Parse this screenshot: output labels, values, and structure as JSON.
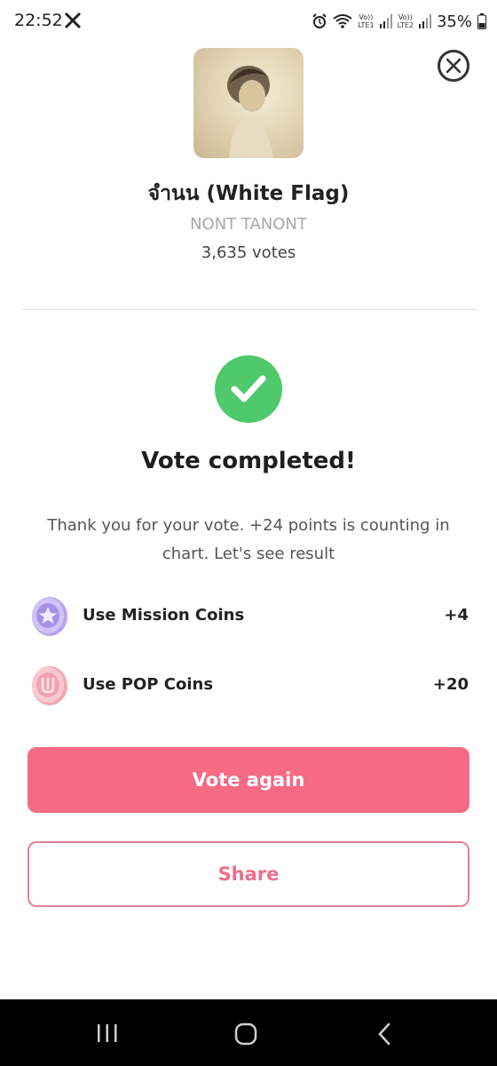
{
  "status_bar": {
    "time": "22:52",
    "sim1": "Vo))\nLTE1",
    "sim2": "Vo))\nLTE2",
    "battery": "35%"
  },
  "song": {
    "title": "จำนน (White Flag)",
    "artist": "NONT TANONT",
    "votes": "3,635 votes"
  },
  "result": {
    "title": "Vote completed!",
    "message": "Thank you for your vote. +24 points is counting in chart. Let's see result"
  },
  "coins": [
    {
      "label": "Use Mission Coins",
      "value": "+4",
      "icon": "mission-coin-icon"
    },
    {
      "label": "Use POP Coins",
      "value": "+20",
      "icon": "pop-coin-icon"
    }
  ],
  "buttons": {
    "vote_again": "Vote again",
    "share": "Share"
  },
  "colors": {
    "accent_pink": "#f66a86",
    "success_green": "#4fc96b"
  }
}
